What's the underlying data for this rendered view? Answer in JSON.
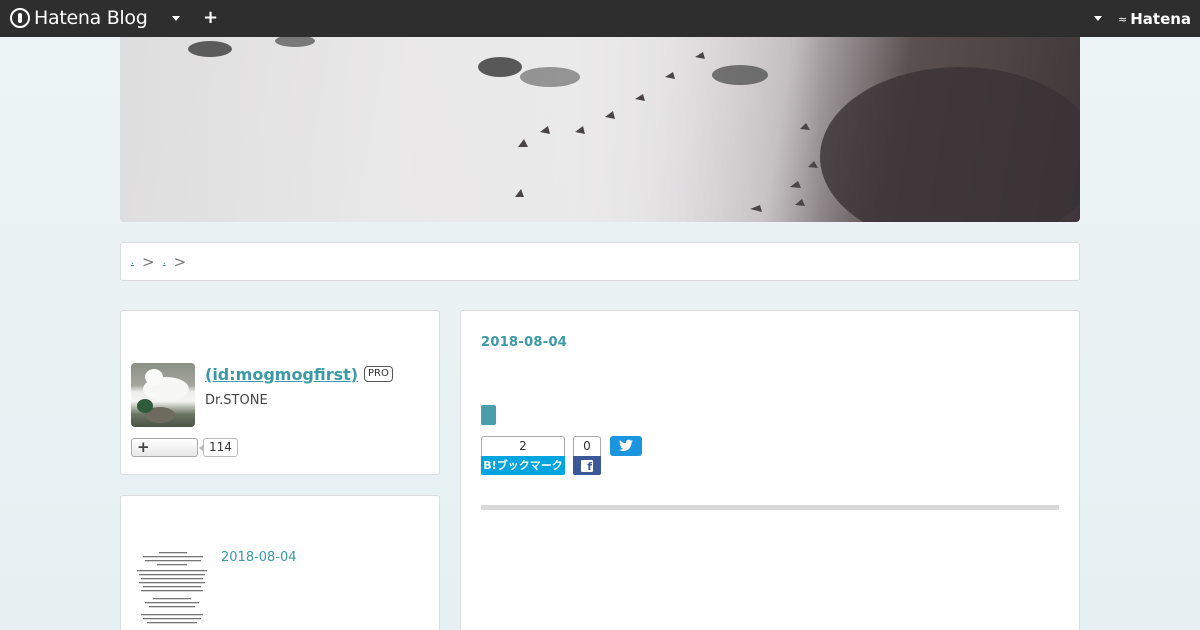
{
  "navbar": {
    "brand": "Hatena Blog",
    "right_brand": "Hatena"
  },
  "breadcrumb": {
    "links": [
      ".",
      "."
    ],
    "separator": ">"
  },
  "profile": {
    "name": " (id:mogmogfirst)",
    "badge": "PRO",
    "description": "Dr.STONE",
    "follow_count": "114"
  },
  "recent": {
    "date": "2018-08-04"
  },
  "article": {
    "date": "2018-08-04",
    "bookmark_count": "2",
    "bookmark_label": "B!ブックマーク",
    "facebook_count": "0"
  },
  "colors": {
    "accent": "#3a9aa6",
    "navbar": "#2e2e2e",
    "hatena_bookmark": "#00a4de",
    "facebook": "#3b5998",
    "twitter": "#1b95e0"
  }
}
